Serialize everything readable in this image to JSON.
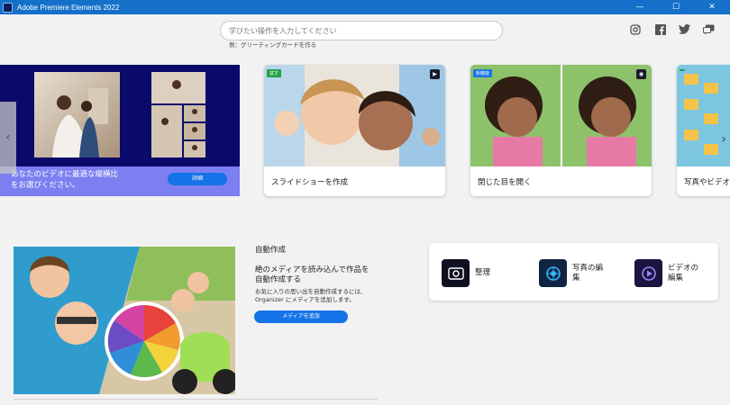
{
  "window": {
    "title": "Adobe Premiere Elements 2022",
    "min_glyph": "—",
    "max_glyph": "☐",
    "close_glyph": "✕"
  },
  "search": {
    "placeholder": "学びたい操作を入力してください",
    "hint": "例：グリーティングカードを作る"
  },
  "social": [
    "instagram-icon",
    "facebook-icon",
    "twitter-icon",
    "feedback-icon"
  ],
  "carousel": {
    "banner": {
      "message": "あなたのビデオに最適な縦横比\nをお選びください。",
      "button": "詳細"
    },
    "cards": [
      {
        "badge": "試す",
        "label": "スライドショーを作成"
      },
      {
        "badge": "新機能",
        "label": "閉じた目を開く"
      },
      {
        "badge": "",
        "label": "写真やビデオを"
      }
    ],
    "prev_glyph": "‹",
    "next_glyph": "›"
  },
  "auto_create": {
    "title": "自動作成",
    "heading": "絶のメディアを読み込んで作品を自動作成する",
    "description": "お気に入りの思い出を自動作成するには、Organizer にメディアを追加します。",
    "button": "メディアを追加"
  },
  "quick_actions": [
    {
      "label": "整理",
      "icon": "organize-icon"
    },
    {
      "label": "写真の編\n集",
      "icon": "photo-edit-icon"
    },
    {
      "label": "ビデオの\n編集",
      "icon": "video-edit-icon"
    }
  ],
  "colors": {
    "titlebar": "#1570c9",
    "accent": "#1473e6",
    "banner": "#0a0a6a",
    "banner_lower": "#7b7ff0"
  }
}
